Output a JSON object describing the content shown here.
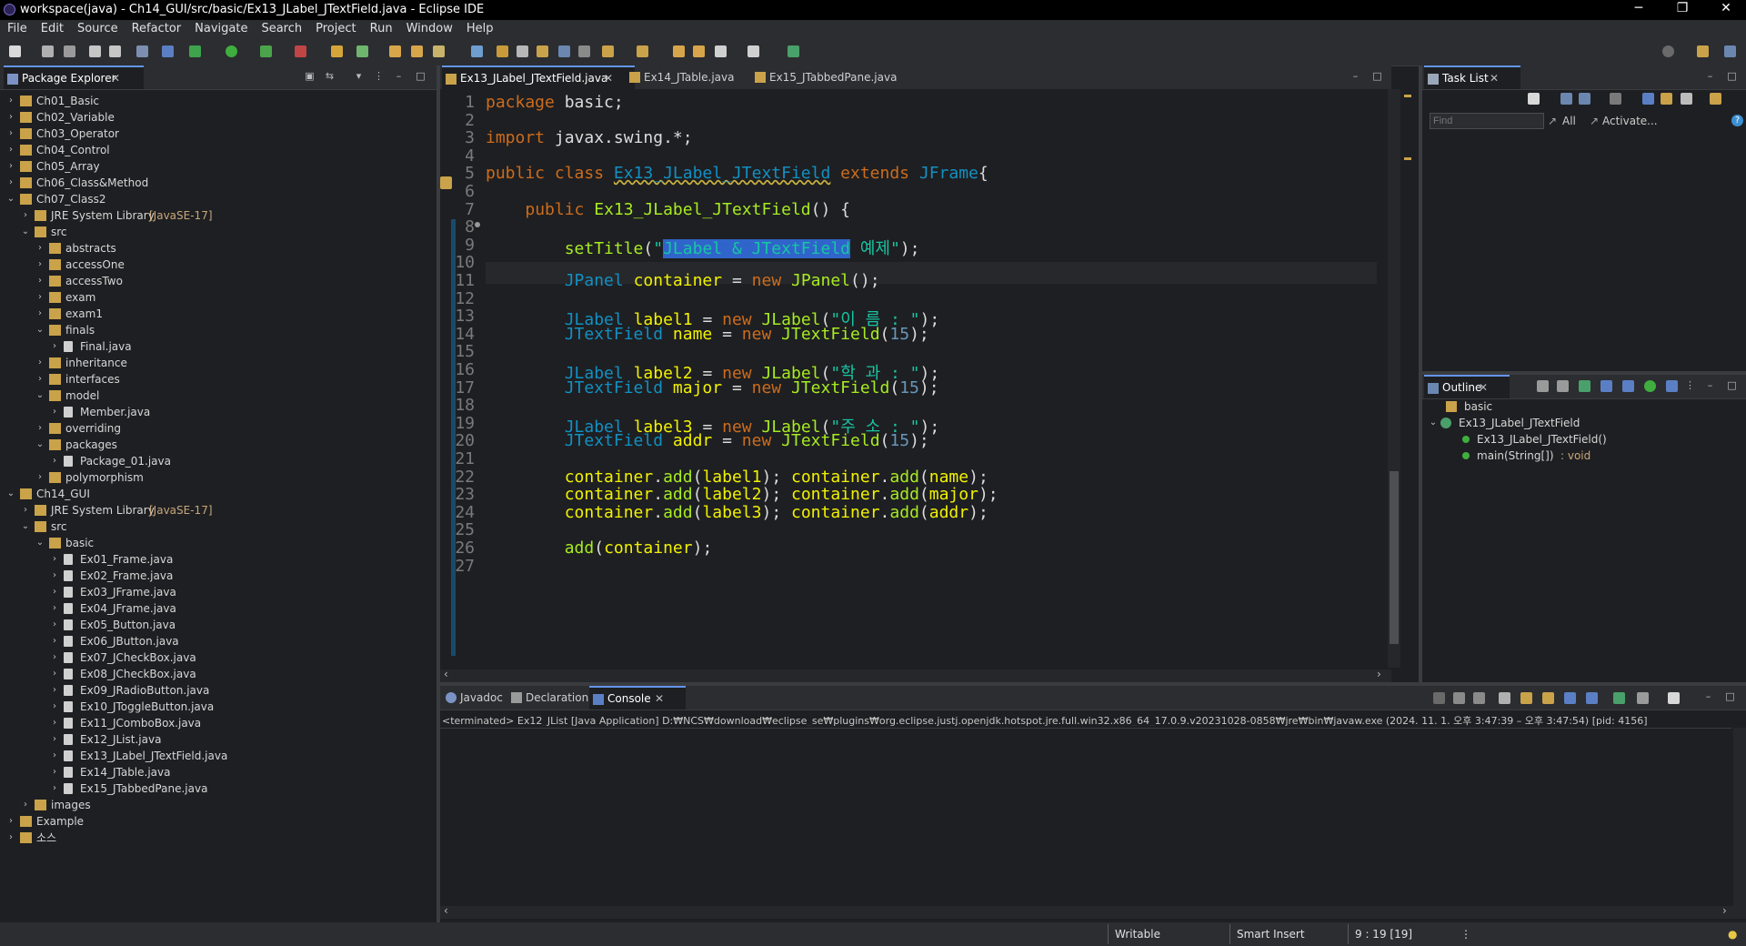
{
  "window": {
    "title": "workspace(java) - Ch14_GUI/src/basic/Ex13_JLabel_JTextField.java - Eclipse IDE",
    "minimize": "─",
    "restore": "❐",
    "close": "✕"
  },
  "menu": [
    "File",
    "Edit",
    "Source",
    "Refactor",
    "Navigate",
    "Search",
    "Project",
    "Run",
    "Window",
    "Help"
  ],
  "package_explorer": {
    "title": "Package Explorer",
    "items": [
      {
        "label": "Ch01_Basic",
        "indent": 0,
        "chev": "›",
        "icon": "project"
      },
      {
        "label": "Ch02_Variable",
        "indent": 0,
        "chev": "›",
        "icon": "project"
      },
      {
        "label": "Ch03_Operator",
        "indent": 0,
        "chev": "›",
        "icon": "project"
      },
      {
        "label": "Ch04_Control",
        "indent": 0,
        "chev": "›",
        "icon": "project"
      },
      {
        "label": "Ch05_Array",
        "indent": 0,
        "chev": "›",
        "icon": "project"
      },
      {
        "label": "Ch06_Class&Method",
        "indent": 0,
        "chev": "›",
        "icon": "project"
      },
      {
        "label": "Ch07_Class2",
        "indent": 0,
        "chev": "⌄",
        "icon": "project"
      },
      {
        "label": "JRE System Library",
        "decor": "[JavaSE-17]",
        "indent": 1,
        "chev": "›",
        "icon": "library"
      },
      {
        "label": "src",
        "indent": 1,
        "chev": "⌄",
        "icon": "srcfolder"
      },
      {
        "label": "abstracts",
        "indent": 2,
        "chev": "›",
        "icon": "package"
      },
      {
        "label": "accessOne",
        "indent": 2,
        "chev": "›",
        "icon": "package"
      },
      {
        "label": "accessTwo",
        "indent": 2,
        "chev": "›",
        "icon": "package"
      },
      {
        "label": "exam",
        "indent": 2,
        "chev": "›",
        "icon": "package"
      },
      {
        "label": "exam1",
        "indent": 2,
        "chev": "›",
        "icon": "package"
      },
      {
        "label": "finals",
        "indent": 2,
        "chev": "⌄",
        "icon": "package"
      },
      {
        "label": "Final.java",
        "indent": 3,
        "chev": "›",
        "icon": "javafile"
      },
      {
        "label": "inheritance",
        "indent": 2,
        "chev": "›",
        "icon": "package"
      },
      {
        "label": "interfaces",
        "indent": 2,
        "chev": "›",
        "icon": "package"
      },
      {
        "label": "model",
        "indent": 2,
        "chev": "⌄",
        "icon": "package"
      },
      {
        "label": "Member.java",
        "indent": 3,
        "chev": "›",
        "icon": "javafile"
      },
      {
        "label": "overriding",
        "indent": 2,
        "chev": "›",
        "icon": "package"
      },
      {
        "label": "packages",
        "indent": 2,
        "chev": "⌄",
        "icon": "package"
      },
      {
        "label": "Package_01.java",
        "indent": 3,
        "chev": "›",
        "icon": "javafile"
      },
      {
        "label": "polymorphism",
        "indent": 2,
        "chev": "›",
        "icon": "package"
      },
      {
        "label": "Ch14_GUI",
        "indent": 0,
        "chev": "⌄",
        "icon": "project"
      },
      {
        "label": "JRE System Library",
        "decor": "[JavaSE-17]",
        "indent": 1,
        "chev": "›",
        "icon": "library"
      },
      {
        "label": "src",
        "indent": 1,
        "chev": "⌄",
        "icon": "srcfolder"
      },
      {
        "label": "basic",
        "indent": 2,
        "chev": "⌄",
        "icon": "package"
      },
      {
        "label": "Ex01_Frame.java",
        "indent": 3,
        "chev": "›",
        "icon": "javafile"
      },
      {
        "label": "Ex02_Frame.java",
        "indent": 3,
        "chev": "›",
        "icon": "javafile"
      },
      {
        "label": "Ex03_JFrame.java",
        "indent": 3,
        "chev": "›",
        "icon": "javafile"
      },
      {
        "label": "Ex04_JFrame.java",
        "indent": 3,
        "chev": "›",
        "icon": "javafile"
      },
      {
        "label": "Ex05_Button.java",
        "indent": 3,
        "chev": "›",
        "icon": "javafile"
      },
      {
        "label": "Ex06_JButton.java",
        "indent": 3,
        "chev": "›",
        "icon": "javafile"
      },
      {
        "label": "Ex07_JCheckBox.java",
        "indent": 3,
        "chev": "›",
        "icon": "javafile"
      },
      {
        "label": "Ex08_JCheckBox.java",
        "indent": 3,
        "chev": "›",
        "icon": "javafile"
      },
      {
        "label": "Ex09_JRadioButton.java",
        "indent": 3,
        "chev": "›",
        "icon": "javafile"
      },
      {
        "label": "Ex10_JToggleButton.java",
        "indent": 3,
        "chev": "›",
        "icon": "javafile"
      },
      {
        "label": "Ex11_JComboBox.java",
        "indent": 3,
        "chev": "›",
        "icon": "javafile"
      },
      {
        "label": "Ex12_JList.java",
        "indent": 3,
        "chev": "›",
        "icon": "javafile"
      },
      {
        "label": "Ex13_JLabel_JTextField.java",
        "indent": 3,
        "chev": "›",
        "icon": "javafile"
      },
      {
        "label": "Ex14_JTable.java",
        "indent": 3,
        "chev": "›",
        "icon": "javafile"
      },
      {
        "label": "Ex15_JTabbedPane.java",
        "indent": 3,
        "chev": "›",
        "icon": "javafile"
      },
      {
        "label": "images",
        "indent": 1,
        "chev": "›",
        "icon": "folder"
      },
      {
        "label": "Example",
        "indent": 0,
        "chev": "›",
        "icon": "project"
      },
      {
        "label": "소스",
        "indent": 0,
        "chev": "›",
        "icon": "project"
      }
    ]
  },
  "editor": {
    "tabs": [
      {
        "label": "Ex13_JLabel_JTextField.java",
        "active": true,
        "close": "✕"
      },
      {
        "label": "Ex14_JTable.java",
        "active": false
      },
      {
        "label": "Ex15_JTabbedPane.java",
        "active": false
      }
    ],
    "lines": [
      {
        "n": "1",
        "html": "<span class=\"kw\">package</span> basic;"
      },
      {
        "n": "2",
        "html": ""
      },
      {
        "n": "3",
        "html": "<span class=\"kw\">import</span> javax.swing.*;"
      },
      {
        "n": "4",
        "html": ""
      },
      {
        "n": "5",
        "html": "<span class=\"kw\">public class</span> <span class=\"cls\">Ex13_JLabel_JTextField</span> <span class=\"kw\">extends</span> <span class=\"ty\">JFrame</span>{"
      },
      {
        "n": "6",
        "html": ""
      },
      {
        "n": "7",
        "html": "    <span class=\"kw\">public</span> <span class=\"fn\">Ex13_JLabel_JTextField</span>() {"
      },
      {
        "n": "8",
        "html": ""
      },
      {
        "n": "9",
        "html": "        <span class=\"fn\">setTitle</span>(<span class=\"str\">\"</span><span class=\"sel\">JLabel &amp; JTextField</span><span class=\"str\"> 예제\"</span>);"
      },
      {
        "n": "10",
        "html": ""
      },
      {
        "n": "11",
        "html": "        <span class=\"ty\">JPanel</span> <span class=\"var\">container</span> = <span class=\"kw\">new</span> <span class=\"fn\">JPanel</span>();"
      },
      {
        "n": "12",
        "html": ""
      },
      {
        "n": "13",
        "html": "        <span class=\"ty\">JLabel</span> <span class=\"var\">label1</span> = <span class=\"kw\">new</span> <span class=\"fn\">JLabel</span>(<span class=\"str\">\"이 름 : \"</span>);"
      },
      {
        "n": "14",
        "html": "        <span class=\"ty\">JTextField</span> <span class=\"var\">name</span> = <span class=\"kw\">new</span> <span class=\"fn\">JTextField</span>(<span class=\"num\">15</span>);"
      },
      {
        "n": "15",
        "html": ""
      },
      {
        "n": "16",
        "html": "        <span class=\"ty\">JLabel</span> <span class=\"var\">label2</span> = <span class=\"kw\">new</span> <span class=\"fn\">JLabel</span>(<span class=\"str\">\"학 과 : \"</span>);"
      },
      {
        "n": "17",
        "html": "        <span class=\"ty\">JTextField</span> <span class=\"var\">major</span> = <span class=\"kw\">new</span> <span class=\"fn\">JTextField</span>(<span class=\"num\">15</span>);"
      },
      {
        "n": "18",
        "html": ""
      },
      {
        "n": "19",
        "html": "        <span class=\"ty\">JLabel</span> <span class=\"var\">label3</span> = <span class=\"kw\">new</span> <span class=\"fn\">JLabel</span>(<span class=\"str\">\"주 소 : \"</span>);"
      },
      {
        "n": "20",
        "html": "        <span class=\"ty\">JTextField</span> <span class=\"var\">addr</span> = <span class=\"kw\">new</span> <span class=\"fn\">JTextField</span>(<span class=\"num\">15</span>);"
      },
      {
        "n": "21",
        "html": ""
      },
      {
        "n": "22",
        "html": "        <span class=\"var\">container</span>.<span class=\"fn\">add</span>(<span class=\"var\">label1</span>); <span class=\"var\">container</span>.<span class=\"fn\">add</span>(<span class=\"var\">name</span>);"
      },
      {
        "n": "23",
        "html": "        <span class=\"var\">container</span>.<span class=\"fn\">add</span>(<span class=\"var\">label2</span>); <span class=\"var\">container</span>.<span class=\"fn\">add</span>(<span class=\"var\">major</span>);"
      },
      {
        "n": "24",
        "html": "        <span class=\"var\">container</span>.<span class=\"fn\">add</span>(<span class=\"var\">label3</span>); <span class=\"var\">container</span>.<span class=\"fn\">add</span>(<span class=\"var\">addr</span>);"
      },
      {
        "n": "25",
        "html": ""
      },
      {
        "n": "26",
        "html": "        <span class=\"fn\">add</span>(<span class=\"var\">container</span>);"
      },
      {
        "n": "27",
        "html": ""
      }
    ]
  },
  "task_list": {
    "title": "Task List",
    "find_placeholder": "Find",
    "all": "All",
    "activate": "Activate..."
  },
  "outline": {
    "title": "Outline",
    "items": [
      {
        "label": "basic",
        "icon": "package"
      },
      {
        "label": "Ex13_JLabel_JTextField",
        "icon": "class"
      },
      {
        "label": "Ex13_JLabel_JTextField()",
        "icon": "constructor"
      },
      {
        "label": "main(String[])",
        "decor": ": void",
        "icon": "method"
      }
    ]
  },
  "bottom": {
    "tabs": [
      {
        "label": "Javadoc"
      },
      {
        "label": "Declaration"
      },
      {
        "label": "Console",
        "active": true,
        "close": "✕"
      }
    ],
    "console_header": "<terminated> Ex12_JList [Java Application] D:₩NCS₩download₩eclipse_se₩plugins₩org.eclipse.justj.openjdk.hotspot.jre.full.win32.x86_64_17.0.9.v20231028-0858₩jre₩bin₩javaw.exe  (2024. 11. 1. 오후 3:47:39 – 오후 3:47:54) [pid: 4156]"
  },
  "status": {
    "writable": "Writable",
    "insert": "Smart Insert",
    "position": "9 : 19 [19]"
  },
  "colors": {
    "accent": "#6495ed",
    "keyword": "#cc6c1d",
    "type": "#1290c3",
    "string": "#17c6a3"
  }
}
